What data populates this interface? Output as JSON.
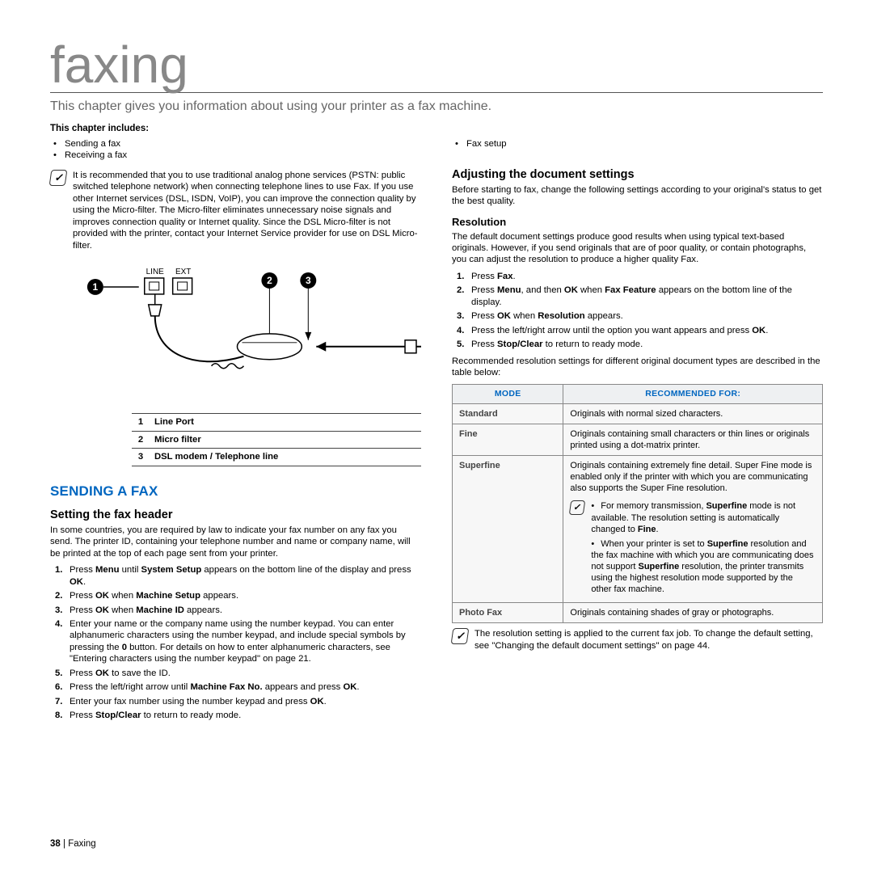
{
  "title": "faxing",
  "intro": "This chapter gives you information about using your printer as a fax machine.",
  "includes_head": "This chapter includes:",
  "includes_left": [
    "Sending a fax",
    "Receiving a fax"
  ],
  "includes_right": [
    "Fax setup"
  ],
  "note1": "It is recommended that you to use traditional analog phone services (PSTN: public switched telephone network) when connecting telephone lines to use Fax. If you use other Internet services (DSL, ISDN, VoIP), you can improve the connection quality by using the Micro-filter. The Micro-filter eliminates unnecessary noise signals and improves connection quality or Internet quality. Since the DSL Micro-filter is not provided with the printer, contact your Internet Service provider for use on DSL Micro-filter.",
  "diagram_labels": {
    "line": "LINE",
    "ext": "EXT"
  },
  "legend": [
    {
      "n": "1",
      "t": "Line Port"
    },
    {
      "n": "2",
      "t": "Micro filter"
    },
    {
      "n": "3",
      "t": "DSL modem / Telephone line"
    }
  ],
  "h1_send": "SENDING A FAX",
  "h2_header": "Setting the fax header",
  "header_intro": "In some countries, you are required by law to indicate your fax number on any fax you send. The printer ID, containing your telephone number and name or company name, will be printed at the top of each page sent from your printer.",
  "header_steps": [
    [
      "Press ",
      "Menu",
      " until ",
      "System Setup",
      " appears on the bottom line of the display and press ",
      "OK",
      "."
    ],
    [
      "Press ",
      "OK",
      " when ",
      "Machine Setup",
      " appears."
    ],
    [
      "Press ",
      "OK",
      " when ",
      "Machine ID",
      " appears."
    ],
    [
      "Enter your name or the company name using the number keypad. You can enter alphanumeric characters using the number keypad, and include special symbols by pressing the ",
      "0",
      " button. For details on how to enter alphanumeric characters, see \"Entering characters using the number keypad\" on page 21."
    ],
    [
      "Press ",
      "OK",
      " to save the ID."
    ],
    [
      "Press the left/right arrow until ",
      "Machine Fax No.",
      " appears and press ",
      "OK",
      "."
    ],
    [
      "Enter your fax number using the number keypad and press ",
      "OK",
      "."
    ],
    [
      "Press ",
      "Stop/Clear",
      " to return to ready mode."
    ]
  ],
  "h2_adjust": "Adjusting the document settings",
  "adjust_intro": "Before starting to fax, change the following settings according to your original's status to get the best quality.",
  "h3_res": "Resolution",
  "res_intro": "The default document settings produce good results when using typical text-based originals. However, if you send originals that are of poor quality, or contain photographs, you can adjust the resolution to produce a higher quality Fax.",
  "res_steps": [
    [
      "Press ",
      "Fax",
      "."
    ],
    [
      "Press ",
      "Menu",
      ", and then ",
      "OK",
      " when ",
      "Fax Feature",
      " appears on the bottom line of the display."
    ],
    [
      "Press ",
      "OK",
      " when ",
      "Resolution",
      " appears."
    ],
    [
      "Press the left/right arrow until the option you want appears and press ",
      "OK",
      "."
    ],
    [
      "Press ",
      "Stop/Clear",
      " to return to ready mode."
    ]
  ],
  "res_table_intro": "Recommended resolution settings for different original document types are described in the table below:",
  "table_headers": [
    "MODE",
    "RECOMMENDED FOR:"
  ],
  "modes": {
    "standard": {
      "label": "Standard",
      "desc": "Originals with normal sized characters."
    },
    "fine": {
      "label": "Fine",
      "desc": "Originals containing small characters or thin lines or originals printed using a dot-matrix printer."
    },
    "superfine": {
      "label": "Superfine",
      "desc": "Originals containing extremely fine detail. Super Fine mode is enabled only if the printer with which you are communicating also supports the Super Fine resolution.",
      "bullets": [
        [
          "For memory transmission, ",
          "Superfine",
          " mode is not available. The resolution setting is automatically changed to ",
          "Fine",
          "."
        ],
        [
          "When your printer is set to ",
          "Superfine",
          " resolution and the fax machine with which you are communicating does not support ",
          "Superfine",
          " resolution, the printer transmits using the highest resolution mode supported by the other fax machine."
        ]
      ]
    },
    "photofax": {
      "label": "Photo Fax",
      "desc": "Originals containing shades of gray or photographs."
    }
  },
  "note2": "The resolution setting is applied to the current fax job. To change the default setting, see \"Changing the default document settings\" on page 44.",
  "footer": {
    "page": "38",
    "sep": "_|",
    "section": "Faxing"
  }
}
